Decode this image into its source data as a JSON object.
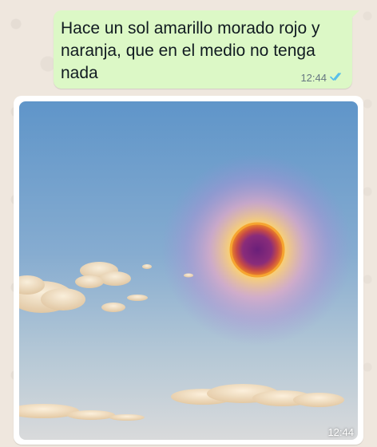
{
  "messages": [
    {
      "type": "text",
      "text": "Hace un sol amarillo morado rojo y naranja, que en el medio no tenga nada",
      "time": "12:44",
      "status": "read",
      "status_icon": "double-check-icon",
      "status_color": "#53bdeb"
    },
    {
      "type": "image",
      "time": "12:44",
      "image_description": null
    }
  ],
  "colors": {
    "outgoing_bubble": "#dcf8c6",
    "image_bubble": "#ffffff",
    "wallpaper": "#efe7de",
    "time_text": "#667781"
  }
}
